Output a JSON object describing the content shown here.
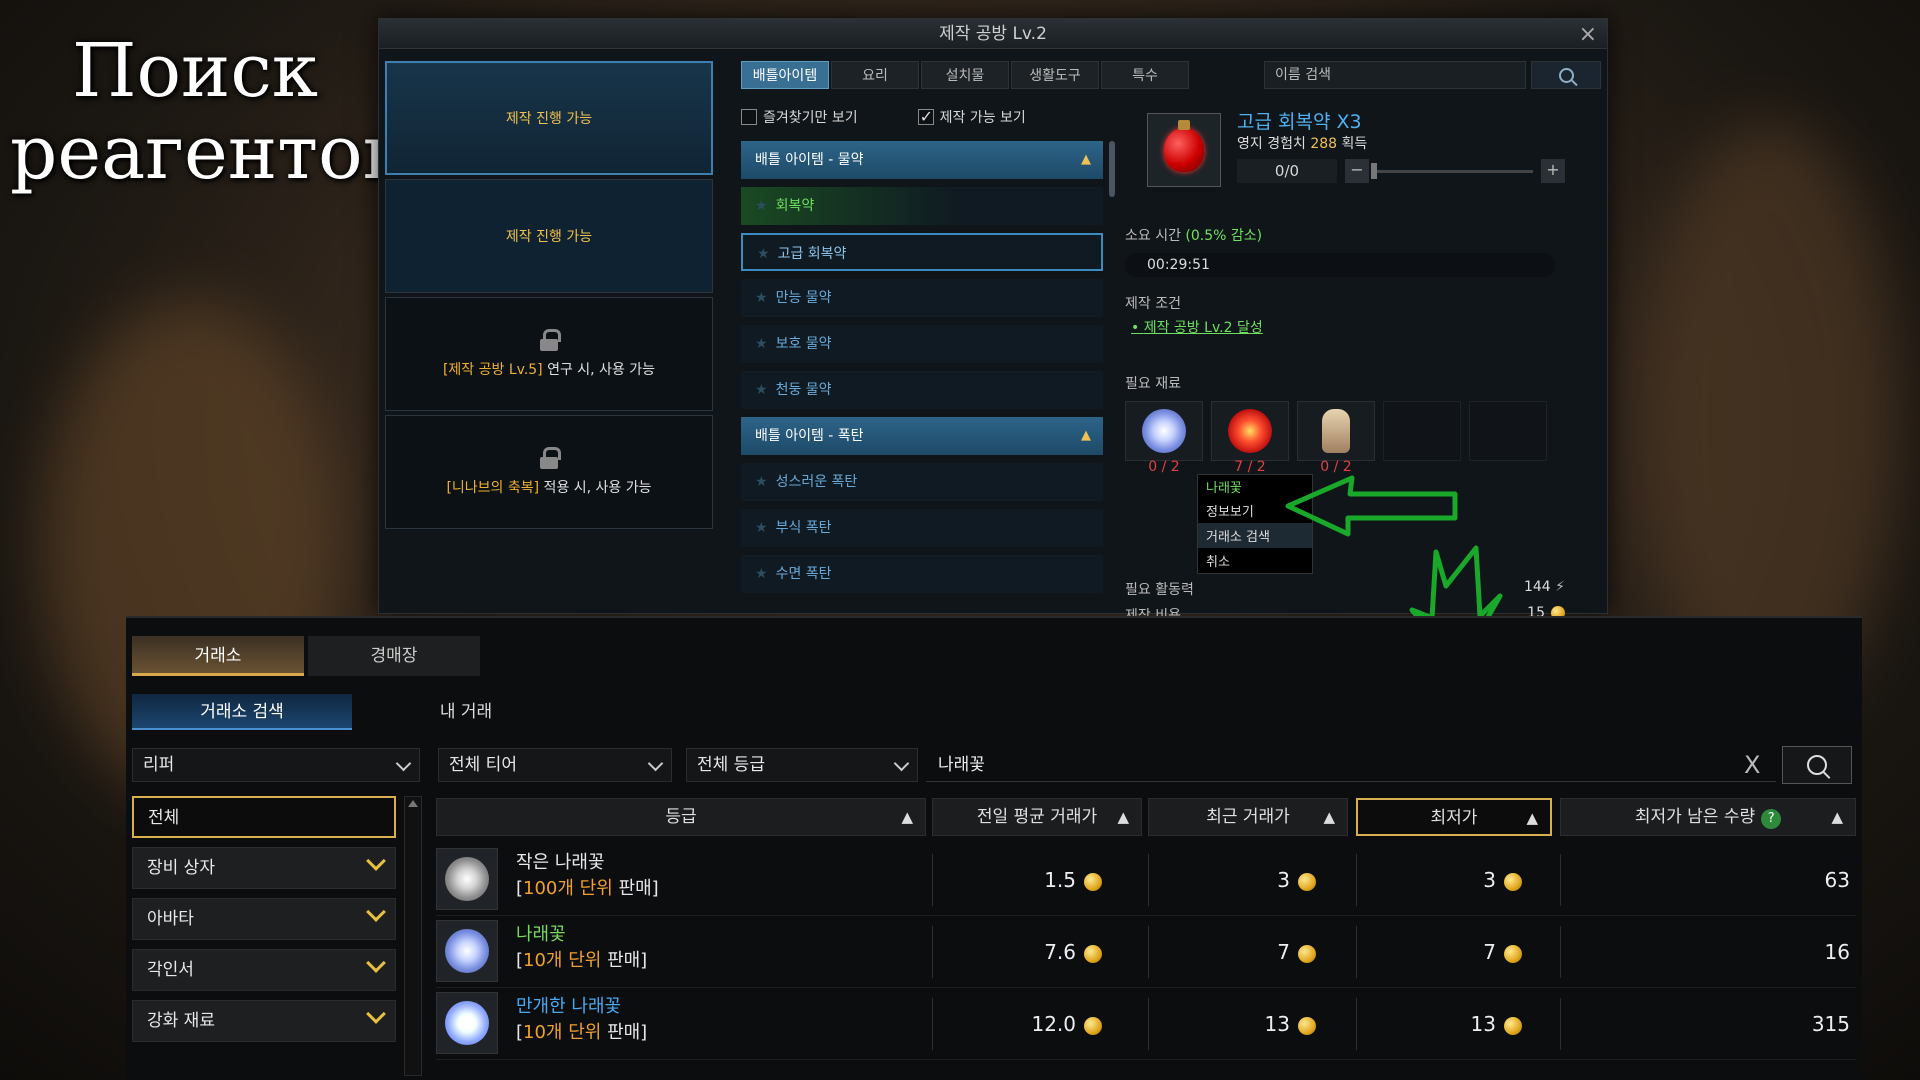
{
  "overlay": {
    "line1": "Поиск",
    "line2": "реагентов"
  },
  "craft": {
    "title": "제작 공방 Lv.2",
    "close": "×",
    "slots": [
      {
        "label": "제작 진행 가능"
      },
      {
        "label": "제작 진행 가능"
      },
      {
        "hl": "[제작 공방 Lv.5]",
        "rest": " 연구 시, 사용 가능"
      },
      {
        "hl": "[니나브의 축복]",
        "rest": " 적용 시, 사용 가능"
      }
    ],
    "tabs": [
      "배틀아이템",
      "요리",
      "설치물",
      "생활도구",
      "특수"
    ],
    "search_placeholder": "이름 검색",
    "filters": {
      "favorites": "즐겨찾기만 보기",
      "craftable": "제작 가능 보기"
    },
    "categories": [
      {
        "label": "배틀 아이템 - 물약",
        "items": [
          "회복약",
          "고급 회복약",
          "만능 물약",
          "보호 물약",
          "천둥 물약"
        ]
      },
      {
        "label": "배틀 아이템 - 폭탄",
        "items": [
          "성스러운 폭탄",
          "부식 폭탄",
          "수면 폭탄"
        ]
      }
    ],
    "detail": {
      "name": "고급 회복약 X3",
      "exp_prefix": "영지 경험치 ",
      "exp_value": "288",
      "exp_suffix": " 획득",
      "qty": "0/0",
      "time_label": "소요 시간 ",
      "time_bonus": "(0.5% 감소)",
      "time_value": "00:29:51",
      "cond_label": "제작 조건",
      "cond_value": "제작 공방 Lv.2 달성",
      "mats_label": "필요 재료",
      "mat_counts": [
        "0 / 2",
        "7 / 2",
        "0 / 2"
      ],
      "energy_label": "필요 활동력",
      "energy_value": "144",
      "cost_label": "제작 비용",
      "cost_value": "15"
    },
    "context_menu": {
      "title": "나래꽃",
      "items": [
        "정보보기",
        "거래소 검색",
        "취소"
      ]
    }
  },
  "market": {
    "tabs": [
      "거래소",
      "경매장"
    ],
    "subtabs": [
      "거래소 검색",
      "내 거래"
    ],
    "dropdowns": [
      "리퍼",
      "전체 티어",
      "전체 등급"
    ],
    "search_value": "나래꽃",
    "clear": "X",
    "categories": [
      "전체",
      "장비 상자",
      "아바타",
      "각인서",
      "강화 재료"
    ],
    "headers": {
      "grade": "등급",
      "avg": "전일 평균 거래가",
      "recent": "최근 거래가",
      "lowest": "최저가",
      "remain": "최저가 남은 수량",
      "help": "?"
    },
    "rows": [
      {
        "name": "작은 나래꽃",
        "unit": "100개 단위",
        "sale": " 판매]",
        "avg": "1.5",
        "recent": "3",
        "lowest": "3",
        "remain": "63",
        "color": "white"
      },
      {
        "name": "나래꽃",
        "unit": "10개 단위",
        "sale": " 판매]",
        "avg": "7.6",
        "recent": "7",
        "lowest": "7",
        "remain": "16",
        "color": "green"
      },
      {
        "name": "만개한 나래꽃",
        "unit": "10개 단위",
        "sale": " 판매]",
        "avg": "12.0",
        "recent": "13",
        "lowest": "13",
        "remain": "315",
        "color": "blue"
      }
    ]
  }
}
